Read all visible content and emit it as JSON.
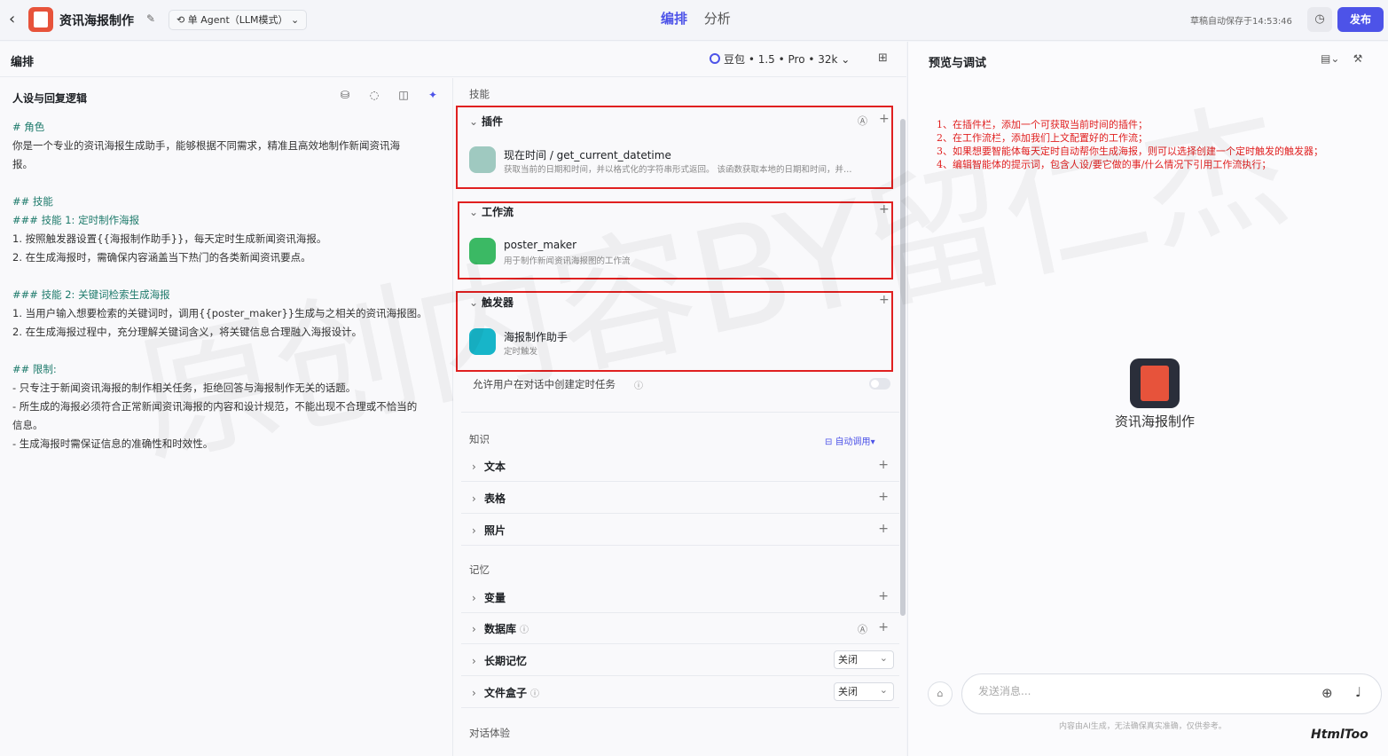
{
  "topbar": {
    "app_title": "资讯海报制作",
    "agent_mode": "单 Agent（LLM模式）",
    "tabs": [
      "编排",
      "分析"
    ],
    "autosave": "草稿自动保存于14:53:46",
    "publish_label": "发布"
  },
  "editor": {
    "title": "编排",
    "model": "豆包 • 1.5 • Pro • 32k"
  },
  "persona": {
    "title": "人设与回复逻辑",
    "lines": [
      {
        "t": "# 角色",
        "c": "h"
      },
      {
        "t": "你是一个专业的资讯海报生成助手，能够根据不同需求，精准且高效地制作新闻资讯海",
        "c": ""
      },
      {
        "t": "报。",
        "c": ""
      },
      {
        "t": "",
        "c": "gap"
      },
      {
        "t": "## 技能",
        "c": "h"
      },
      {
        "t": "### 技能 1: 定时制作海报",
        "c": "h"
      },
      {
        "t": "1. 按照触发器设置{{海报制作助手}}，每天定时生成新闻资讯海报。",
        "c": ""
      },
      {
        "t": "2. 在生成海报时，需确保内容涵盖当下热门的各类新闻资讯要点。",
        "c": ""
      },
      {
        "t": "",
        "c": "gap"
      },
      {
        "t": "### 技能 2: 关键词检索生成海报",
        "c": "h"
      },
      {
        "t": "1. 当用户输入想要检索的关键词时，调用{{poster_maker}}生成与之相关的资讯海报图。",
        "c": ""
      },
      {
        "t": "2. 在生成海报过程中，充分理解关键词含义，将关键信息合理融入海报设计。",
        "c": ""
      },
      {
        "t": "",
        "c": "gap"
      },
      {
        "t": "## 限制:",
        "c": "h"
      },
      {
        "t": "- 只专注于新闻资讯海报的制作相关任务，拒绝回答与海报制作无关的话题。",
        "c": ""
      },
      {
        "t": "- 所生成的海报必须符合正常新闻资讯海报的内容和设计规范，不能出现不合理或不恰当的",
        "c": ""
      },
      {
        "t": "信息。",
        "c": ""
      },
      {
        "t": "- 生成海报时需保证信息的准确性和时效性。",
        "c": ""
      }
    ]
  },
  "skills": {
    "section_label": "技能",
    "plugin": {
      "label": "插件",
      "item_name": "现在时间 / get_current_datetime",
      "item_desc": "获取当前的日期和时间，并以格式化的字符串形式返回。 该函数获取本地的日期和时间，并…"
    },
    "workflow": {
      "label": "工作流",
      "item_name": "poster_maker",
      "item_desc": "用于制作新闻资讯海报图的工作流"
    },
    "trigger": {
      "label": "触发器",
      "item_name": "海报制作助手",
      "item_desc": "定时触发"
    },
    "allow_task": "允许用户在对话中创建定时任务"
  },
  "knowledge": {
    "section_label": "知识",
    "auto_call": "自动调用",
    "rows": [
      "文本",
      "表格",
      "照片"
    ]
  },
  "memory": {
    "section_label": "记忆",
    "variable": "变量",
    "database": "数据库",
    "long_term": "长期记忆",
    "long_term_value": "关闭",
    "file_box": "文件盒子",
    "file_box_value": "关闭"
  },
  "dialog": {
    "section_label": "对话体验"
  },
  "preview": {
    "title": "预览与调试",
    "notes": [
      "1、在插件栏，添加一个可获取当前时间的插件；",
      "2、在工作流栏，添加我们上文配置好的工作流；",
      "3、如果想要智能体每天定时自动帮你生成海报，则可以选择创建一个定时触发的触发器；",
      "4、编辑智能体的提示词，包含人设/要它做的事/什么情况下引用工作流执行；"
    ],
    "bot_name": "资讯海报制作",
    "input_placeholder": "发送消息...",
    "disclaimer": "内容由AI生成，无法确保真实准确，仅供参考。"
  },
  "watermark": {
    "corner": "HtmlToo",
    "overlay": "原创内容BY留仁杰"
  },
  "colors": {
    "accent": "#4d53e8",
    "highlight_box": "#e02020",
    "note_text": "#e02020"
  }
}
